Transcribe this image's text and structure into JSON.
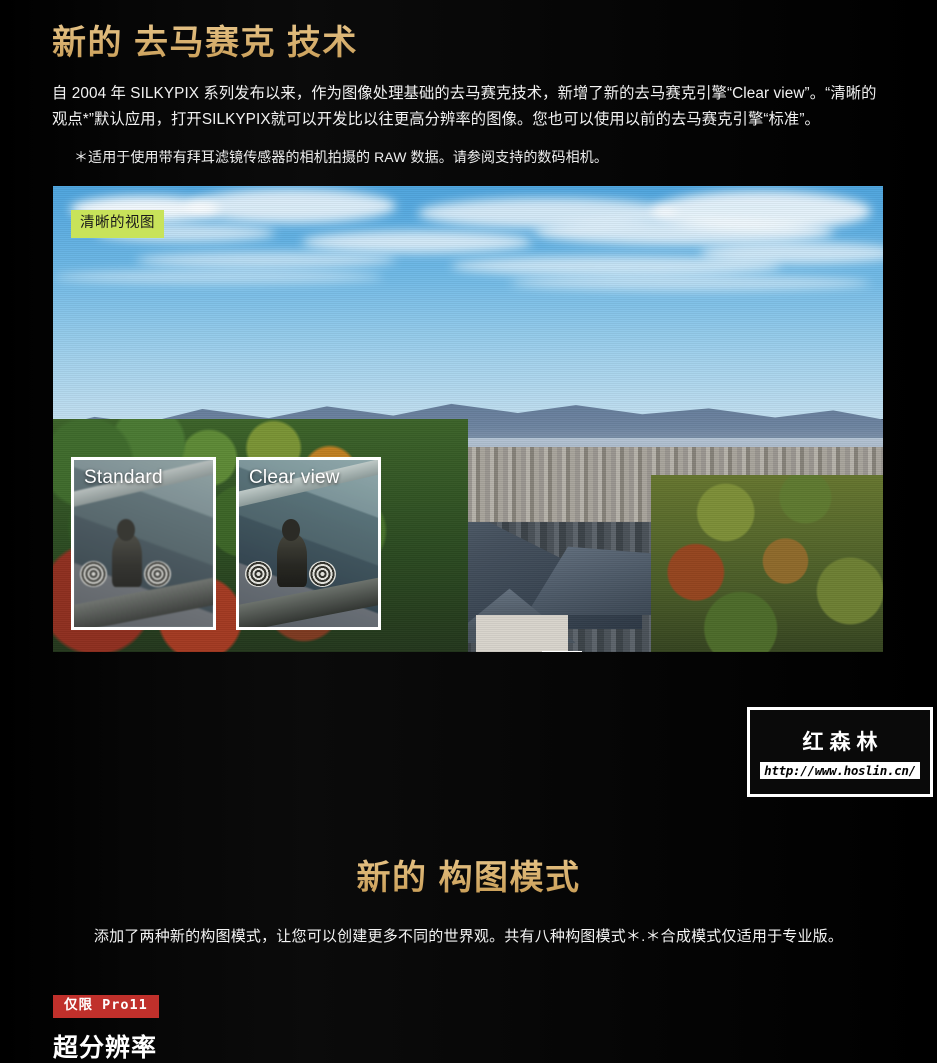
{
  "demosaic": {
    "title": "新的 去马赛克 技术",
    "body": "自 2004 年 SILKYPIX 系列发布以来，作为图像处理基础的去马赛克技术，新增了新的去马赛克引擎“Clear view”。“清晰的观点*”默认应用，打开SILKYPIX就可以开发比以往更高分辨率的图像。您也可以使用以前的去马赛克引擎“标准”。",
    "footnote": "＊适用于使用带有拜耳滤镜传感器的相机拍摄的 RAW 数据。请参阅支持的数码相机。",
    "photo": {
      "chip_label": "清晰的视图",
      "crops": [
        {
          "label": "Standard"
        },
        {
          "label": "Clear view"
        }
      ]
    }
  },
  "watermark": {
    "name": "红森林",
    "url": "http://www.hoslin.cn/"
  },
  "composition": {
    "title": "新的 构图模式",
    "lead": "添加了两种新的构图模式，让您可以创建更多不同的世界观。共有八种构图模式＊.＊合成模式仅适用于专业版。",
    "badge": "仅限 Pro11",
    "subhead": "超分辨率"
  },
  "colors": {
    "gold": "#e2bd7e",
    "badge_red": "#c0302b",
    "chip_green": "#c8e35a",
    "background": "#050505"
  }
}
